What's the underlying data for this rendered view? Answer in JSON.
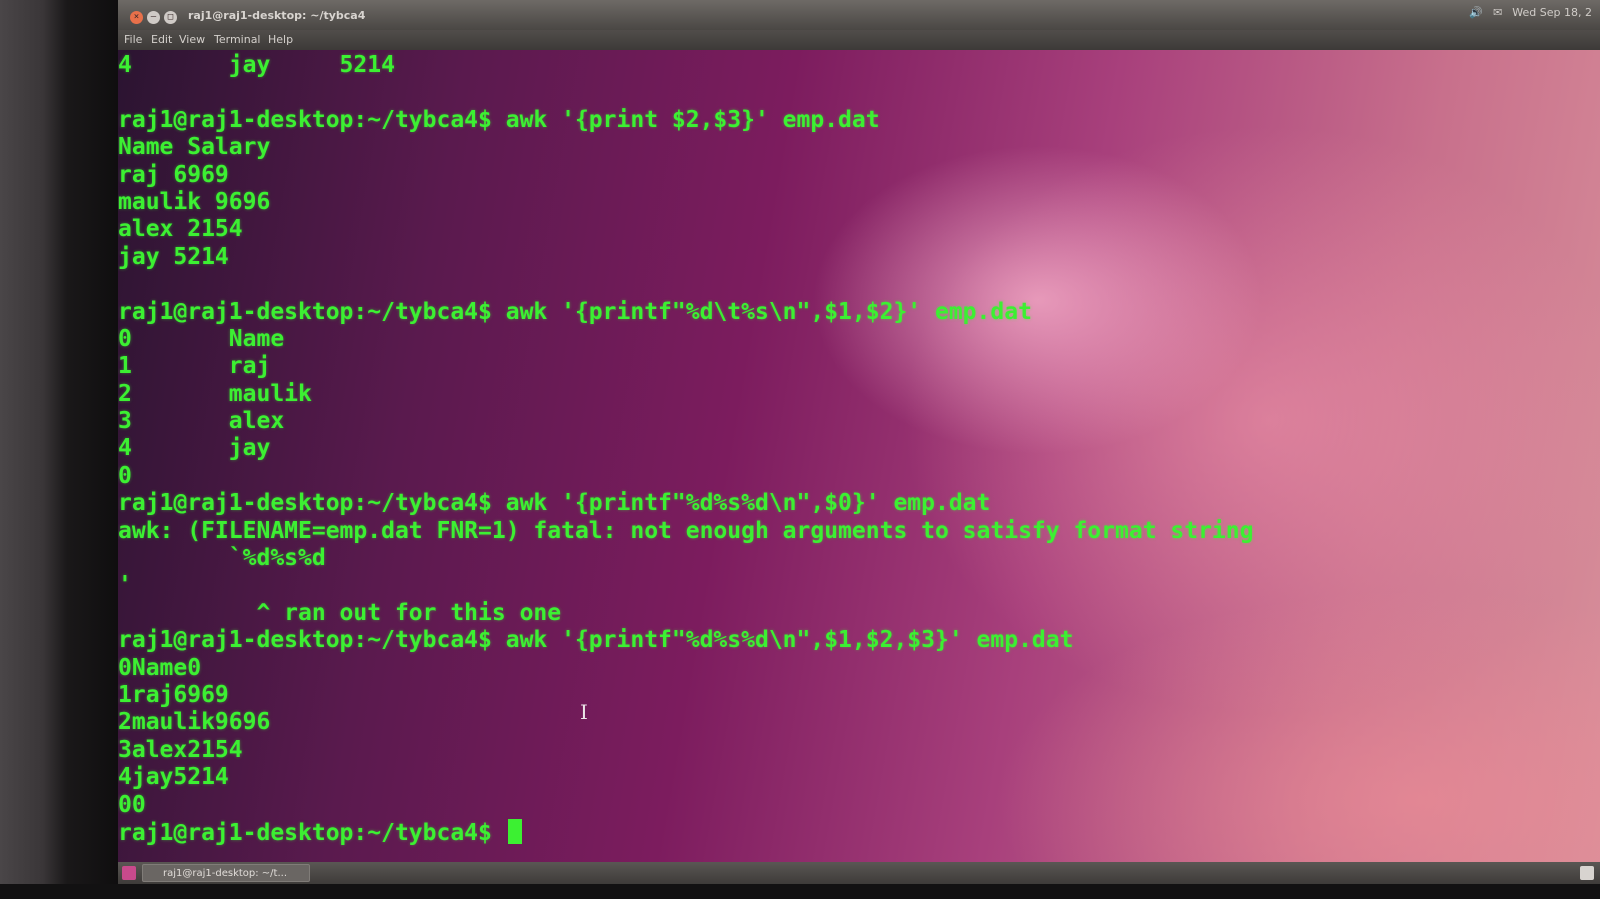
{
  "window": {
    "title": "raj1@raj1-desktop: ~/tybca4",
    "clock": "Wed Sep 18, 2",
    "controls": [
      "×",
      "–",
      "□"
    ]
  },
  "menu": [
    "File",
    "Edit",
    "View",
    "Terminal",
    "Help"
  ],
  "terminal": {
    "lines": [
      "4       jay     5214",
      "",
      "raj1@raj1-desktop:~/tybca4$ awk '{print $2,$3}' emp.dat",
      "Name Salary",
      "raj 6969",
      "maulik 9696",
      "alex 2154",
      "jay 5214",
      "",
      "raj1@raj1-desktop:~/tybca4$ awk '{printf\"%d\\t%s\\n\",$1,$2}' emp.dat",
      "0       Name",
      "1       raj",
      "2       maulik",
      "3       alex",
      "4       jay",
      "0",
      "raj1@raj1-desktop:~/tybca4$ awk '{printf\"%d%s%d\\n\",$0}' emp.dat",
      "awk: (FILENAME=emp.dat FNR=1) fatal: not enough arguments to satisfy format string",
      "        `%d%s%d",
      "'",
      "          ^ ran out for this one",
      "raj1@raj1-desktop:~/tybca4$ awk '{printf\"%d%s%d\\n\",$1,$2,$3}' emp.dat",
      "0Name0",
      "1raj6969",
      "2maulik9696",
      "3alex2154",
      "4jay5214",
      "00"
    ],
    "prompt": "raj1@raj1-desktop:~/tybca4$ "
  },
  "taskbar": {
    "item": "raj1@raj1-desktop: ~/t..."
  },
  "colors": {
    "terminal_text": "#3cf032",
    "background_dark": "#5a1a4e",
    "background_light": "#d8909a"
  }
}
